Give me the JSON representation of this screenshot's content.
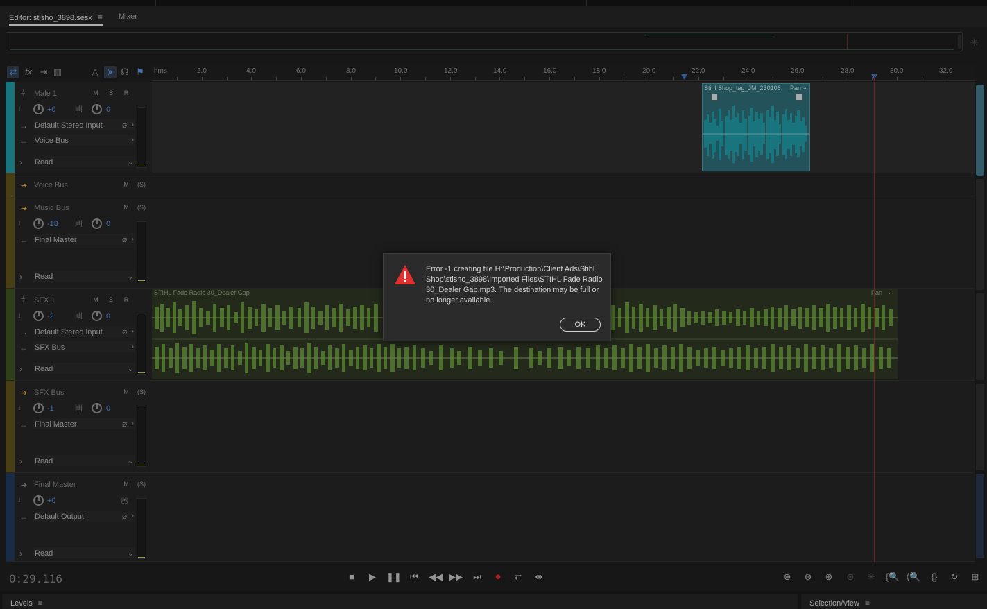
{
  "tabs": {
    "editor_label": "Editor: stisho_3898.sesx",
    "mixer_label": "Mixer"
  },
  "ruler": {
    "unit": "hms",
    "ticks": [
      "2.0",
      "4.0",
      "6.0",
      "8.0",
      "10.0",
      "12.0",
      "14.0",
      "16.0",
      "18.0",
      "20.0",
      "22.0",
      "24.0",
      "26.0",
      "28.0",
      "30.0",
      "32.0"
    ]
  },
  "tracks": {
    "male1": {
      "name": "Male 1",
      "volume": "+0",
      "pan": "0",
      "input": "Default Stereo Input",
      "output": "Voice Bus",
      "automation": "Read",
      "color": "#1e8f9a",
      "clip": {
        "title": "Stihl Shop_tag_JM_230106",
        "pan": "Pan"
      }
    },
    "voicebus": {
      "name": "Voice Bus",
      "color": "#5b4c1a"
    },
    "musicbus": {
      "name": "Music Bus",
      "volume": "-18",
      "pan": "0",
      "output": "Final Master",
      "automation": "Read",
      "color": "#5b4c1a"
    },
    "sfx1": {
      "name": "SFX 1",
      "volume": "-2",
      "pan": "0",
      "input": "Default Stereo Input",
      "output": "SFX Bus",
      "automation": "Read",
      "color": "#3a4f1e",
      "clip": {
        "title": "STIHL Fade Radio 30_Dealer Gap",
        "pan": "Pan"
      }
    },
    "sfxbus": {
      "name": "SFX Bus",
      "volume": "-1",
      "pan": "0",
      "output": "Final Master",
      "automation": "Read",
      "color": "#5b4c1a"
    },
    "finalmaster": {
      "name": "Final Master",
      "volume": "+0",
      "output": "Default Output",
      "automation": "Read",
      "color": "#1f3656"
    }
  },
  "labels": {
    "mute": "M",
    "solo": "S",
    "rec": "R",
    "solo_bus": "(S)"
  },
  "transport": {
    "timecode": "0:29.116"
  },
  "dialog": {
    "message": "Error -1 creating file H:\\Production\\Client Ads\\Stihl Shop\\stisho_3898\\Imported Files\\STIHL Fade Radio 30_Dealer Gap.mp3.  The destination may be full or no longer available.",
    "ok_label": "OK"
  },
  "panels": {
    "levels": "Levels",
    "selection": "Selection/View"
  },
  "colors": {
    "playhead": "#a32222",
    "record": "#e02a2a",
    "clip_voice": "#2d6570",
    "clip_sfx": "#5f8a37"
  }
}
